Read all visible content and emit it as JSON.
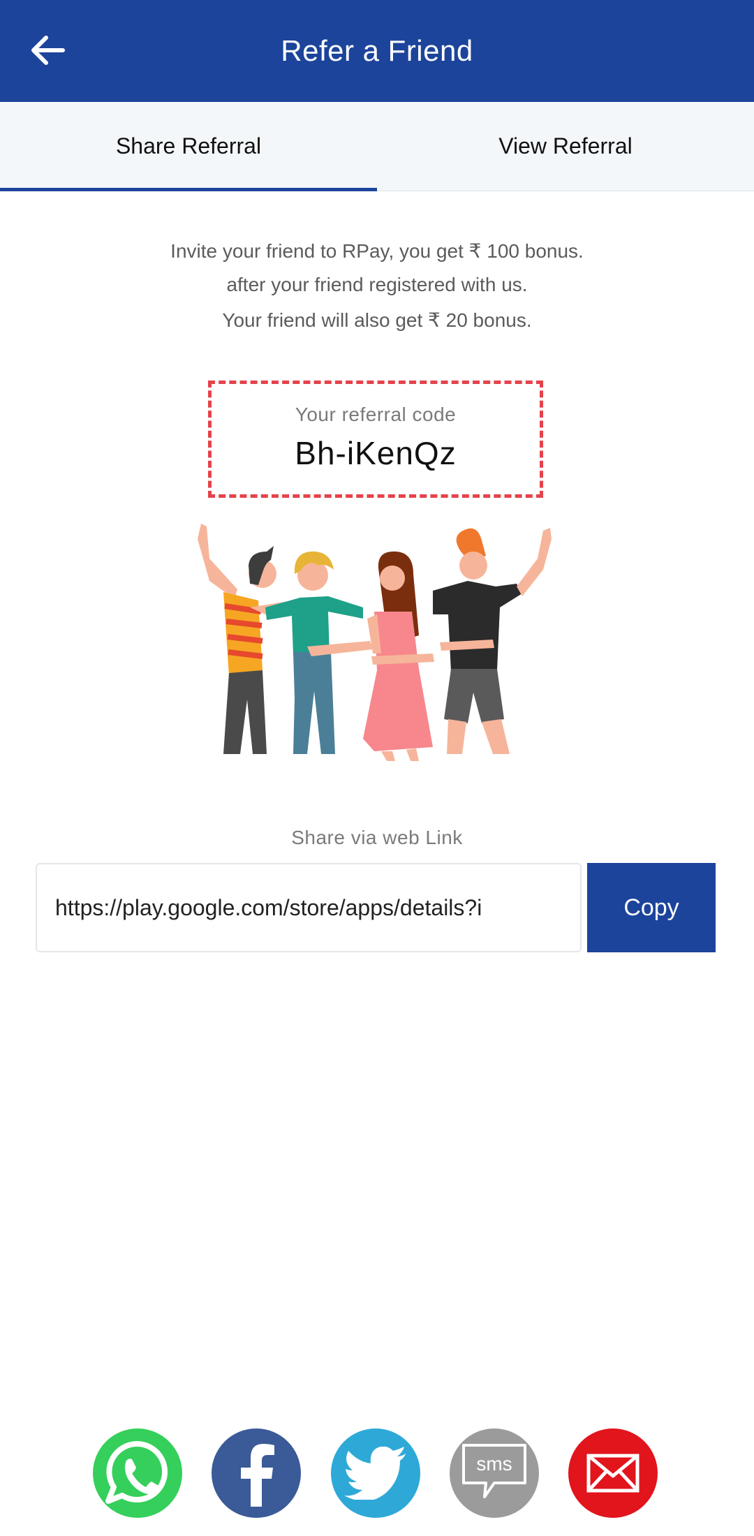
{
  "header": {
    "title": "Refer a Friend",
    "back_icon": "arrow-left-icon"
  },
  "tabs": [
    {
      "label": "Share Referral",
      "active": true
    },
    {
      "label": "View Referral",
      "active": false
    }
  ],
  "invite": {
    "line1": "Invite your friend to RPay, you get ₹ 100 bonus.",
    "line2": "after your friend registered with us.",
    "line3": "Your friend will also get ₹ 20 bonus."
  },
  "referral": {
    "label": "Your referral code",
    "code": "Bh-iKenQz"
  },
  "share": {
    "label": "Share via web Link",
    "link_value": "https://play.google.com/store/apps/details?i",
    "copy_label": "Copy"
  },
  "social": {
    "sms_text": "sms",
    "icons": [
      "whatsapp-icon",
      "facebook-icon",
      "twitter-icon",
      "sms-icon",
      "email-icon"
    ]
  },
  "colors": {
    "primary": "#1c449b",
    "dashed_border": "#e5434b",
    "whatsapp": "#35cf5b",
    "facebook": "#3a5a98",
    "twitter": "#2ea9d7",
    "sms": "#9b9b9b",
    "email": "#e2141c"
  }
}
